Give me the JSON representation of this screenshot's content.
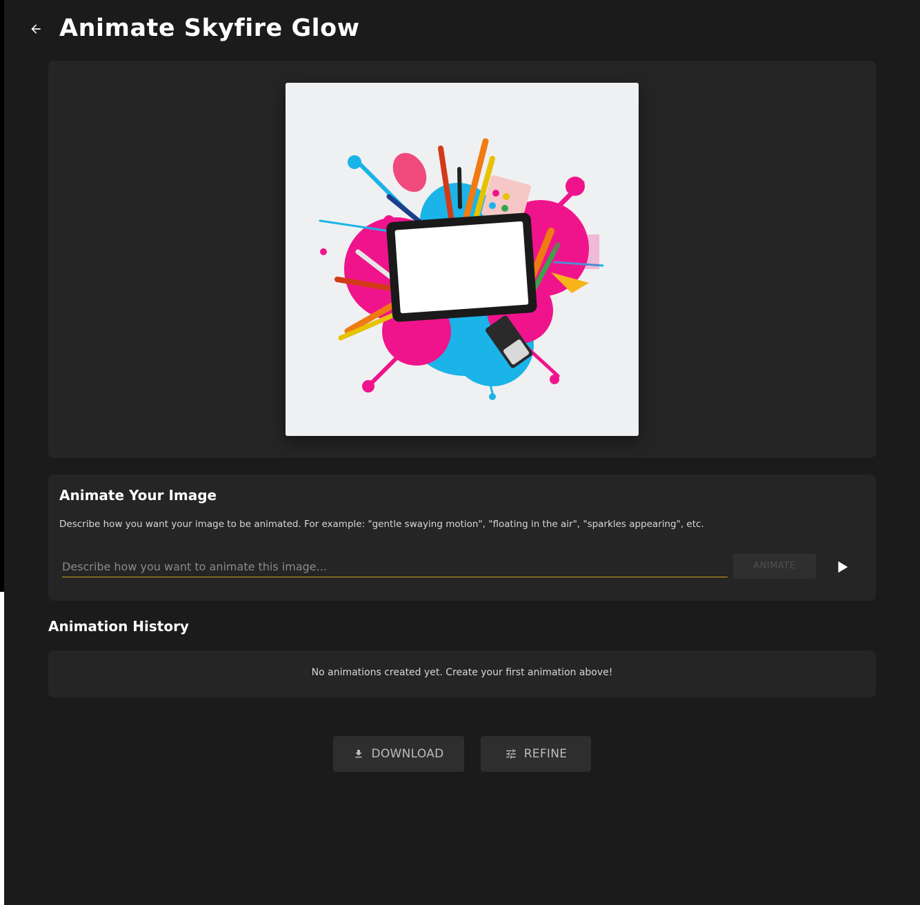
{
  "header": {
    "title": "Animate Skyfire Glow",
    "back_icon": "arrow-left-icon"
  },
  "preview": {
    "image_icon": "artwork-preview-image"
  },
  "animate": {
    "title": "Animate Your Image",
    "description": "Describe how you want your image to be animated. For example: \"gentle swaying motion\", \"floating in the air\", \"sparkles appearing\", etc.",
    "input_value": "",
    "input_placeholder": "Describe how you want to animate this image...",
    "button_label": "ANIMATE",
    "play_icon": "play-icon"
  },
  "history": {
    "title": "Animation History",
    "empty_text": "No animations created yet. Create your first animation above!"
  },
  "actions": {
    "download_label": "DOWNLOAD",
    "download_icon": "download-icon",
    "refine_label": "REFINE",
    "refine_icon": "tune-icon"
  },
  "colors": {
    "background": "#1b1b1b",
    "card": "#252525",
    "accent_underline": "#d4a017",
    "splash_pink": "#f0148c",
    "splash_cyan": "#1ab4e8"
  }
}
